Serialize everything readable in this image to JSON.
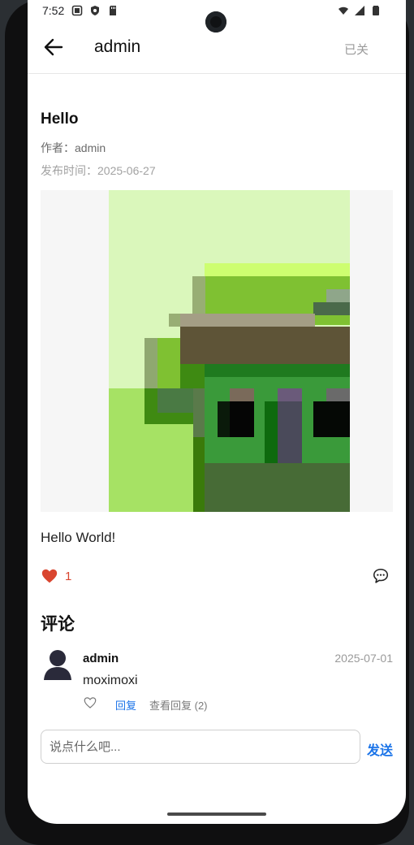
{
  "status_bar": {
    "time": "7:52",
    "left_icons": [
      "screenshot-icon",
      "shield-icon",
      "sd-card-icon"
    ],
    "right_icons": [
      "wifi-icon",
      "signal-icon",
      "battery-icon"
    ]
  },
  "app_bar": {
    "back_icon": "arrow-back-icon",
    "title": "admin",
    "status": "已关"
  },
  "post": {
    "title": "Hello",
    "author": "作者：admin",
    "publish_time": "发布时间：2025-06-27",
    "image_icon": "pixel-art-image",
    "body": "Hello World!",
    "likes": "1",
    "like_icon": "heart-filled-icon",
    "comment_icon": "chat-bubble-icon"
  },
  "comments_section": {
    "title": "评论",
    "comments": [
      {
        "user": "admin",
        "date": "2025-07-01",
        "text": "moximoxi",
        "reply_label": "回复",
        "view_replies_label": "查看回复 (2)"
      }
    ]
  },
  "comment_input": {
    "placeholder": "说点什么吧...",
    "value": "",
    "send_label": "发送"
  },
  "colors": {
    "accent": "#1a73e8",
    "like": "#d9452f"
  }
}
